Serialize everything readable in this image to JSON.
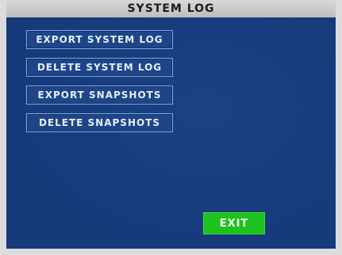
{
  "window": {
    "title": "SYSTEM LOG"
  },
  "menu": {
    "items": [
      {
        "label": "EXPORT SYSTEM LOG"
      },
      {
        "label": "DELETE SYSTEM LOG"
      },
      {
        "label": "EXPORT SNAPSHOTS"
      },
      {
        "label": "DELETE SNAPSHOTS"
      }
    ]
  },
  "footer": {
    "exit_label": "EXIT"
  },
  "colors": {
    "panel_background": "#163a7a",
    "button_border": "#7fa9e0",
    "exit_button": "#1ec21e",
    "title_bar": "#cfcfcf"
  }
}
